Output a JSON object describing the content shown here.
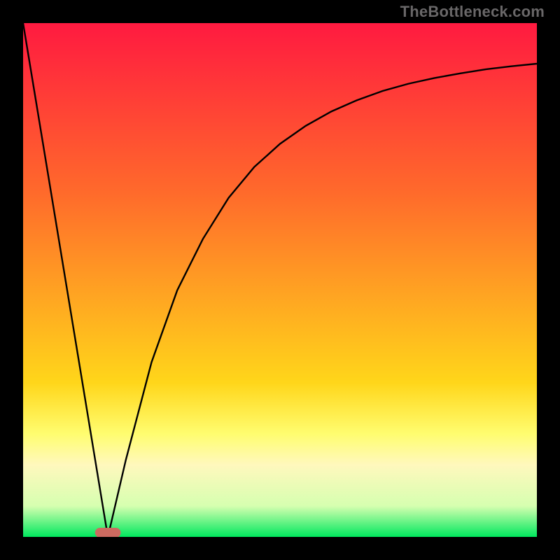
{
  "watermark": "TheBottleneck.com",
  "colors": {
    "black": "#000000",
    "gradient_top": "#ff1a40",
    "gradient_mid1": "#ff6a2b",
    "gradient_mid2": "#ffd61a",
    "gradient_band": "#fff8bd",
    "gradient_green": "#00e85e",
    "curve": "#000000",
    "marker": "#cc6a60"
  },
  "chart_data": {
    "type": "line",
    "title": "",
    "xlabel": "",
    "ylabel": "",
    "xlim": [
      0,
      100
    ],
    "ylim": [
      0,
      100
    ],
    "marker_x_range": [
      14,
      19
    ],
    "series": [
      {
        "name": "left-linear",
        "x": [
          0,
          16.5
        ],
        "y": [
          100,
          0
        ]
      },
      {
        "name": "right-curve",
        "x": [
          16.5,
          20,
          25,
          30,
          35,
          40,
          45,
          50,
          55,
          60,
          65,
          70,
          75,
          80,
          85,
          90,
          95,
          100
        ],
        "y": [
          0,
          15,
          34,
          48,
          58,
          66,
          72,
          76.5,
          80,
          82.8,
          85,
          86.8,
          88.2,
          89.3,
          90.2,
          91,
          91.6,
          92.1
        ]
      }
    ],
    "gradient_stops": [
      {
        "offset": 0.0,
        "color": "#ff1a40"
      },
      {
        "offset": 0.33,
        "color": "#ff6a2b"
      },
      {
        "offset": 0.7,
        "color": "#ffd61a"
      },
      {
        "offset": 0.8,
        "color": "#fffd70"
      },
      {
        "offset": 0.86,
        "color": "#fff8bd"
      },
      {
        "offset": 0.94,
        "color": "#d6ffb0"
      },
      {
        "offset": 1.0,
        "color": "#00e85e"
      }
    ]
  }
}
